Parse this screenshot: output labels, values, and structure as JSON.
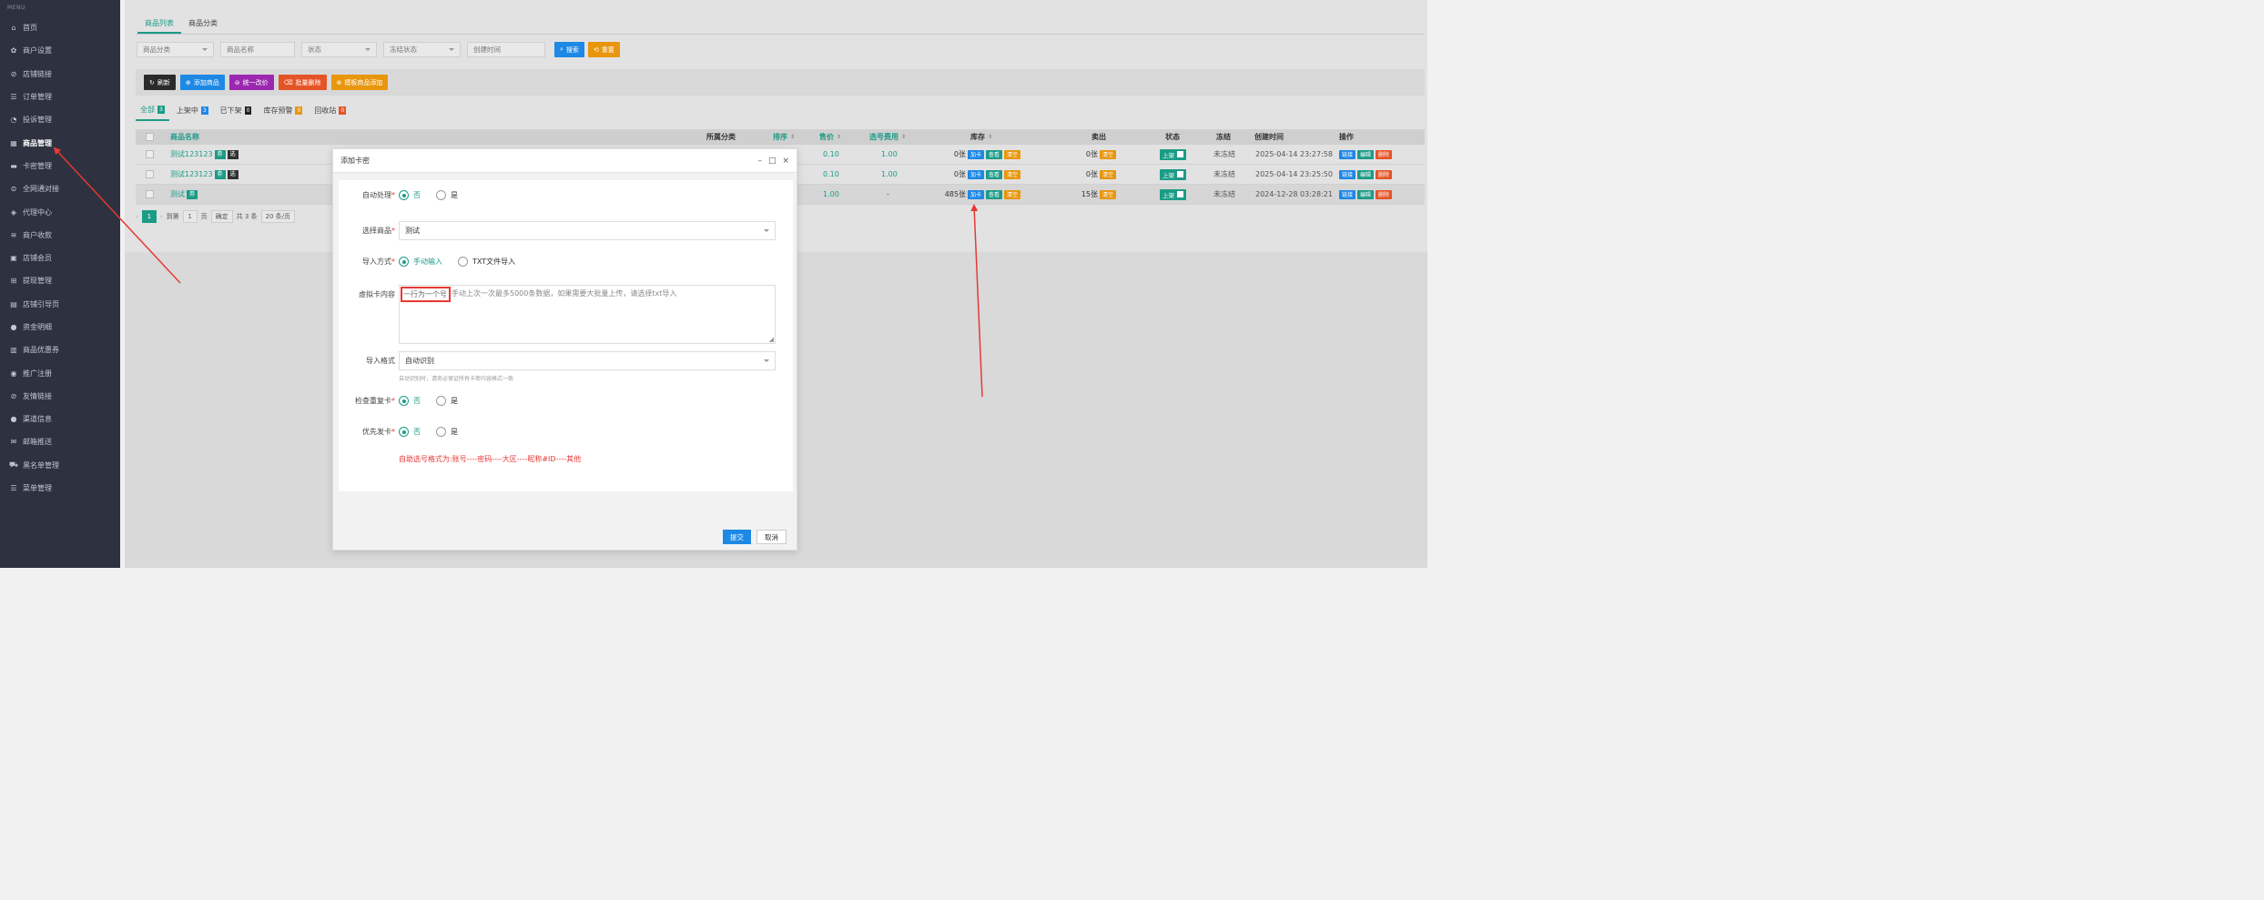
{
  "sidebar": {
    "menu_title": "MENU",
    "items": [
      {
        "label": "首页",
        "icon": "home-icon",
        "glyph": "⌂"
      },
      {
        "label": "商户设置",
        "icon": "gear-icon",
        "glyph": "✿"
      },
      {
        "label": "店铺链接",
        "icon": "link-icon",
        "glyph": "⊘"
      },
      {
        "label": "订单管理",
        "icon": "list-icon",
        "glyph": "☰"
      },
      {
        "label": "投诉管理",
        "icon": "headset-icon",
        "glyph": "◔"
      },
      {
        "label": "商品管理",
        "icon": "grid-icon",
        "glyph": "▦"
      },
      {
        "label": "卡密管理",
        "icon": "card-icon",
        "glyph": "▬"
      },
      {
        "label": "全网通对接",
        "icon": "connect-icon",
        "glyph": "⊜"
      },
      {
        "label": "代理中心",
        "icon": "shield-icon",
        "glyph": "◈"
      },
      {
        "label": "商户收款",
        "icon": "wallet-icon",
        "glyph": "≋"
      },
      {
        "label": "店铺会员",
        "icon": "member-icon",
        "glyph": "▣"
      },
      {
        "label": "提现管理",
        "icon": "bank-icon",
        "glyph": "⊞"
      },
      {
        "label": "店铺引导页",
        "icon": "page-icon",
        "glyph": "▤"
      },
      {
        "label": "资金明细",
        "icon": "coin-icon",
        "glyph": "●"
      },
      {
        "label": "商品优惠券",
        "icon": "coupon-icon",
        "glyph": "▥"
      },
      {
        "label": "推广注册",
        "icon": "promo-icon",
        "glyph": "◉"
      },
      {
        "label": "友情链接",
        "icon": "link-icon",
        "glyph": "⊘"
      },
      {
        "label": "渠道信息",
        "icon": "info-icon",
        "glyph": "●"
      },
      {
        "label": "邮箱推送",
        "icon": "mail-icon",
        "glyph": "✉"
      },
      {
        "label": "黑名单管理",
        "icon": "block-icon",
        "glyph": "⛟"
      },
      {
        "label": "菜单管理",
        "icon": "menu-icon",
        "glyph": "☰"
      }
    ]
  },
  "tabs": {
    "product_list": "商品列表",
    "product_category": "商品分类"
  },
  "filters": {
    "category": "商品分类",
    "name": "商品名称",
    "status": "状态",
    "freeze_status": "冻结状态",
    "created_time": "创建时间",
    "search": "搜索",
    "reset": "重置"
  },
  "actions": {
    "refresh": "刷新",
    "add_product": "添加商品",
    "unify_price": "统一改价",
    "batch_delete": "批量删除",
    "template_add": "模板商品添加"
  },
  "sub_tabs": [
    {
      "label": "全部",
      "count": "3"
    },
    {
      "label": "上架中",
      "count": "3"
    },
    {
      "label": "已下架",
      "count": "0"
    },
    {
      "label": "库存预警",
      "count": "0"
    },
    {
      "label": "回收站",
      "count": "0"
    }
  ],
  "table": {
    "headers": {
      "name": "商品名称",
      "category": "所属分类",
      "sort": "排序",
      "price": "售价",
      "fee": "选号费用",
      "stock": "库存",
      "sold": "卖出",
      "status": "状态",
      "freeze": "冻结",
      "created": "创建时间",
      "ops": "操作"
    },
    "rows": [
      {
        "name": "测试123123",
        "tag1": "券",
        "tag2": "选",
        "price": "0.10",
        "fee": "1.00",
        "stock": "0张",
        "sold": "0张",
        "status": "上架",
        "freeze": "未冻结",
        "created": "2025-04-14 23:27:58"
      },
      {
        "name": "测试123123",
        "tag1": "券",
        "tag2": "选",
        "price": "0.10",
        "fee": "1.00",
        "stock": "0张",
        "sold": "0张",
        "status": "上架",
        "freeze": "未冻结",
        "created": "2025-04-14 23:25:50"
      },
      {
        "name": "测试",
        "tag1": "券",
        "tag2": "",
        "price": "1.00",
        "fee": "-",
        "stock": "485张",
        "sold": "15张",
        "status": "上架",
        "freeze": "未冻结",
        "created": "2024-12-28 03:28:21"
      }
    ],
    "btn_add_card": "加卡",
    "btn_view": "查看",
    "btn_clear": "清空",
    "btn_link": "链接",
    "btn_edit": "编辑",
    "btn_delete": "删除"
  },
  "pagination": {
    "current": "1",
    "goto_label": "到第",
    "page_input": "1",
    "page_unit": "页",
    "confirm": "确定",
    "total": "共 3 条",
    "per_page": "20 条/页"
  },
  "modal": {
    "title": "添加卡密",
    "auto_process_label": "自动处理",
    "opt_no": "否",
    "opt_yes": "是",
    "select_product_label": "选择商品",
    "select_product_value": "测试",
    "import_method_label": "导入方式",
    "import_manual": "手动输入",
    "import_txt": "TXT文件导入",
    "content_label": "虚拟卡内容",
    "content_highlight": "一行为一个号",
    "content_placeholder_rest": "手动上次一次最多5000条数据，如果需要大批量上传，请选择txt导入",
    "import_format_label": "导入格式",
    "import_format_value": "自动识别",
    "import_format_hint": "自动识别时，请务必保证所有卡密内容格式一致",
    "check_dup_label": "检查重复卡",
    "priority_label": "优先发卡",
    "red_note": "自助选号格式为:账号----密码----大区----昵称#ID----其他",
    "submit": "提交",
    "cancel": "取消"
  },
  "colors": {
    "accent": "#1c9b87",
    "primary": "#1e88e5",
    "warning": "#e8960e",
    "danger": "#e55427",
    "annotation": "#e53935"
  }
}
